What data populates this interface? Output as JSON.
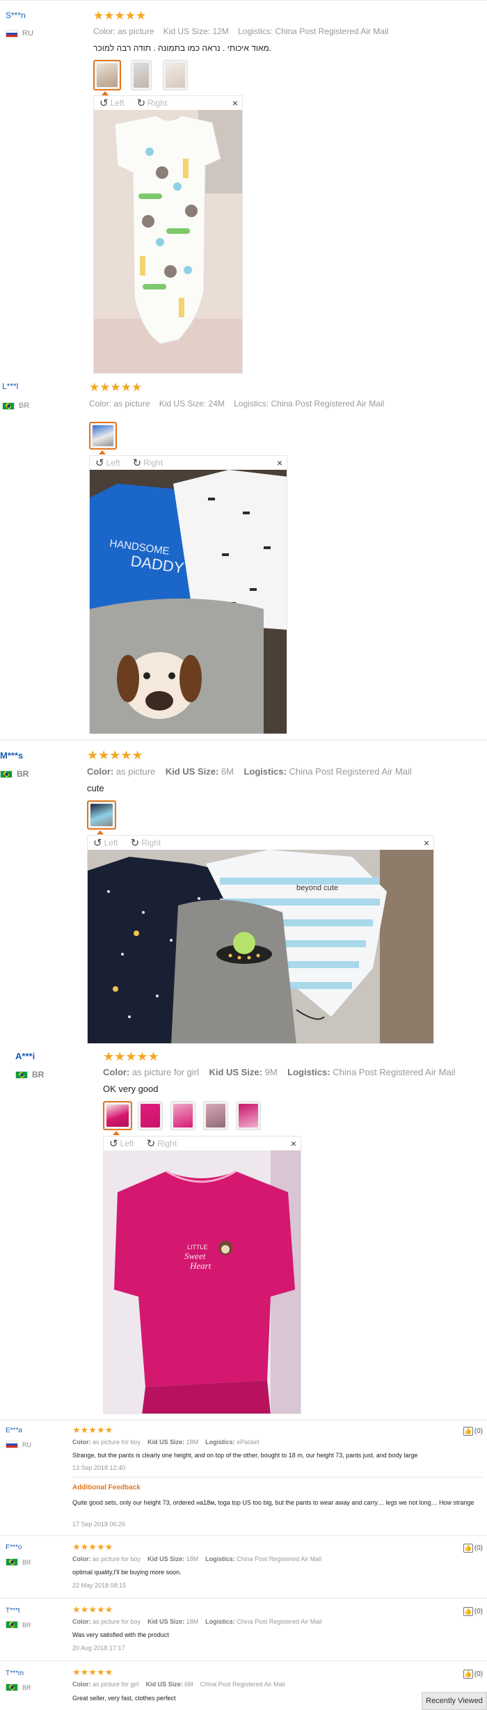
{
  "icons": {
    "star": "star-icon",
    "rotate_left": "rotate-left-icon",
    "rotate_right": "rotate-right-icon",
    "close": "close-icon",
    "thumb_up": "thumb-up-icon"
  },
  "colors": {
    "star": "#f5a623",
    "username": "#1a5fb4",
    "selected_border": "#e4761b",
    "additional_feedback": "#e4761b"
  },
  "stars": "★★★★★",
  "viewer": {
    "left": "Left",
    "right": "Right",
    "close": "×"
  },
  "reviews": [
    {
      "user": "S***n",
      "country": "RU",
      "color_label": "Color:",
      "color": "as picture",
      "size_label": "Kid US Size:",
      "size": "12M",
      "logistics_label": "Logistics:",
      "logistics": "China Post Registered Air Mail",
      "text": ".מאוד איכותי . נראה כמו בתמונה . תודה רבה למוכר",
      "photo_count": 3
    },
    {
      "user": "L***l",
      "country": "BR",
      "color_label": "Color:",
      "color": "as picture",
      "size_label": "Kid US Size:",
      "size": "24M",
      "logistics_label": "Logistics:",
      "logistics": "China Post Registered Air Mail",
      "text": "",
      "photo_count": 1,
      "photo_prints": [
        "HANDSOME",
        "DADDY"
      ]
    },
    {
      "user": "M***s",
      "country": "BR",
      "color_label": "Color:",
      "color": "as picture",
      "size_label": "Kid US Size:",
      "size": "6M",
      "logistics_label": "Logistics:",
      "logistics": "China Post Registered Air Mail",
      "text": "cute",
      "photo_count": 1,
      "photo_prints": [
        "beyond cute"
      ]
    },
    {
      "user": "A***i",
      "country": "BR",
      "color_label": "Color:",
      "color": "as picture for girl",
      "size_label": "Kid US Size:",
      "size": "9M",
      "logistics_label": "Logistics:",
      "logistics": "China Post Registered Air Mail",
      "text": "OK very good",
      "photo_count": 5,
      "photo_prints": [
        "LITTLE",
        "Sweet",
        "Heart"
      ]
    },
    {
      "user": "E***a",
      "country": "RU",
      "color_label": "Color:",
      "color": "as picture for boy",
      "size_label": "Kid US Size:",
      "size": "18M",
      "logistics_label": "Logistics:",
      "logistics": "ePacket",
      "text": "Strange, but the pants is clearly one height, and on top of the other, bought to 18 m, our height 73, pants just, and body large",
      "date": "13 Sep 2018 12:40",
      "additional_label": "Additional Feedback",
      "additional_text": "Quite good sets, only our height 73, ordered на18м, toga top US too big, but the pants to wear away and carry… legs we not long… How strange",
      "additional_date": "17 Sep 2018 06:26",
      "helpful": "(0)"
    },
    {
      "user": "F***o",
      "country": "BR",
      "color_label": "Color:",
      "color": "as picture for boy",
      "size_label": "Kid US Size:",
      "size": "18M",
      "logistics_label": "Logistics:",
      "logistics": "China Post Registered Air Mail",
      "text": "optimal quality,I'll be buying more soon.",
      "date": "22 May 2018 08:15",
      "helpful": "(0)"
    },
    {
      "user": "T***t",
      "country": "BR",
      "color_label": "Color:",
      "color": "as picture for boy",
      "size_label": "Kid US Size:",
      "size": "18M",
      "logistics_label": "Logistics:",
      "logistics": "China Post Registered Air Mail",
      "text": "Was very satisfied with the product",
      "date": "20 Aug 2018 17:17",
      "helpful": "(0)"
    },
    {
      "user": "T***m",
      "country": "BR",
      "color_label": "Color:",
      "color": "as picture for girl",
      "size_label": "Kid US Size:",
      "size": "6M",
      "logistics_label": "Logistics:",
      "logistics": "China Post Registered Air Mail",
      "text": "Great seller, very fast, clothes perfect",
      "helpful": "(0)"
    }
  ],
  "recently_viewed": "Recently Viewed"
}
